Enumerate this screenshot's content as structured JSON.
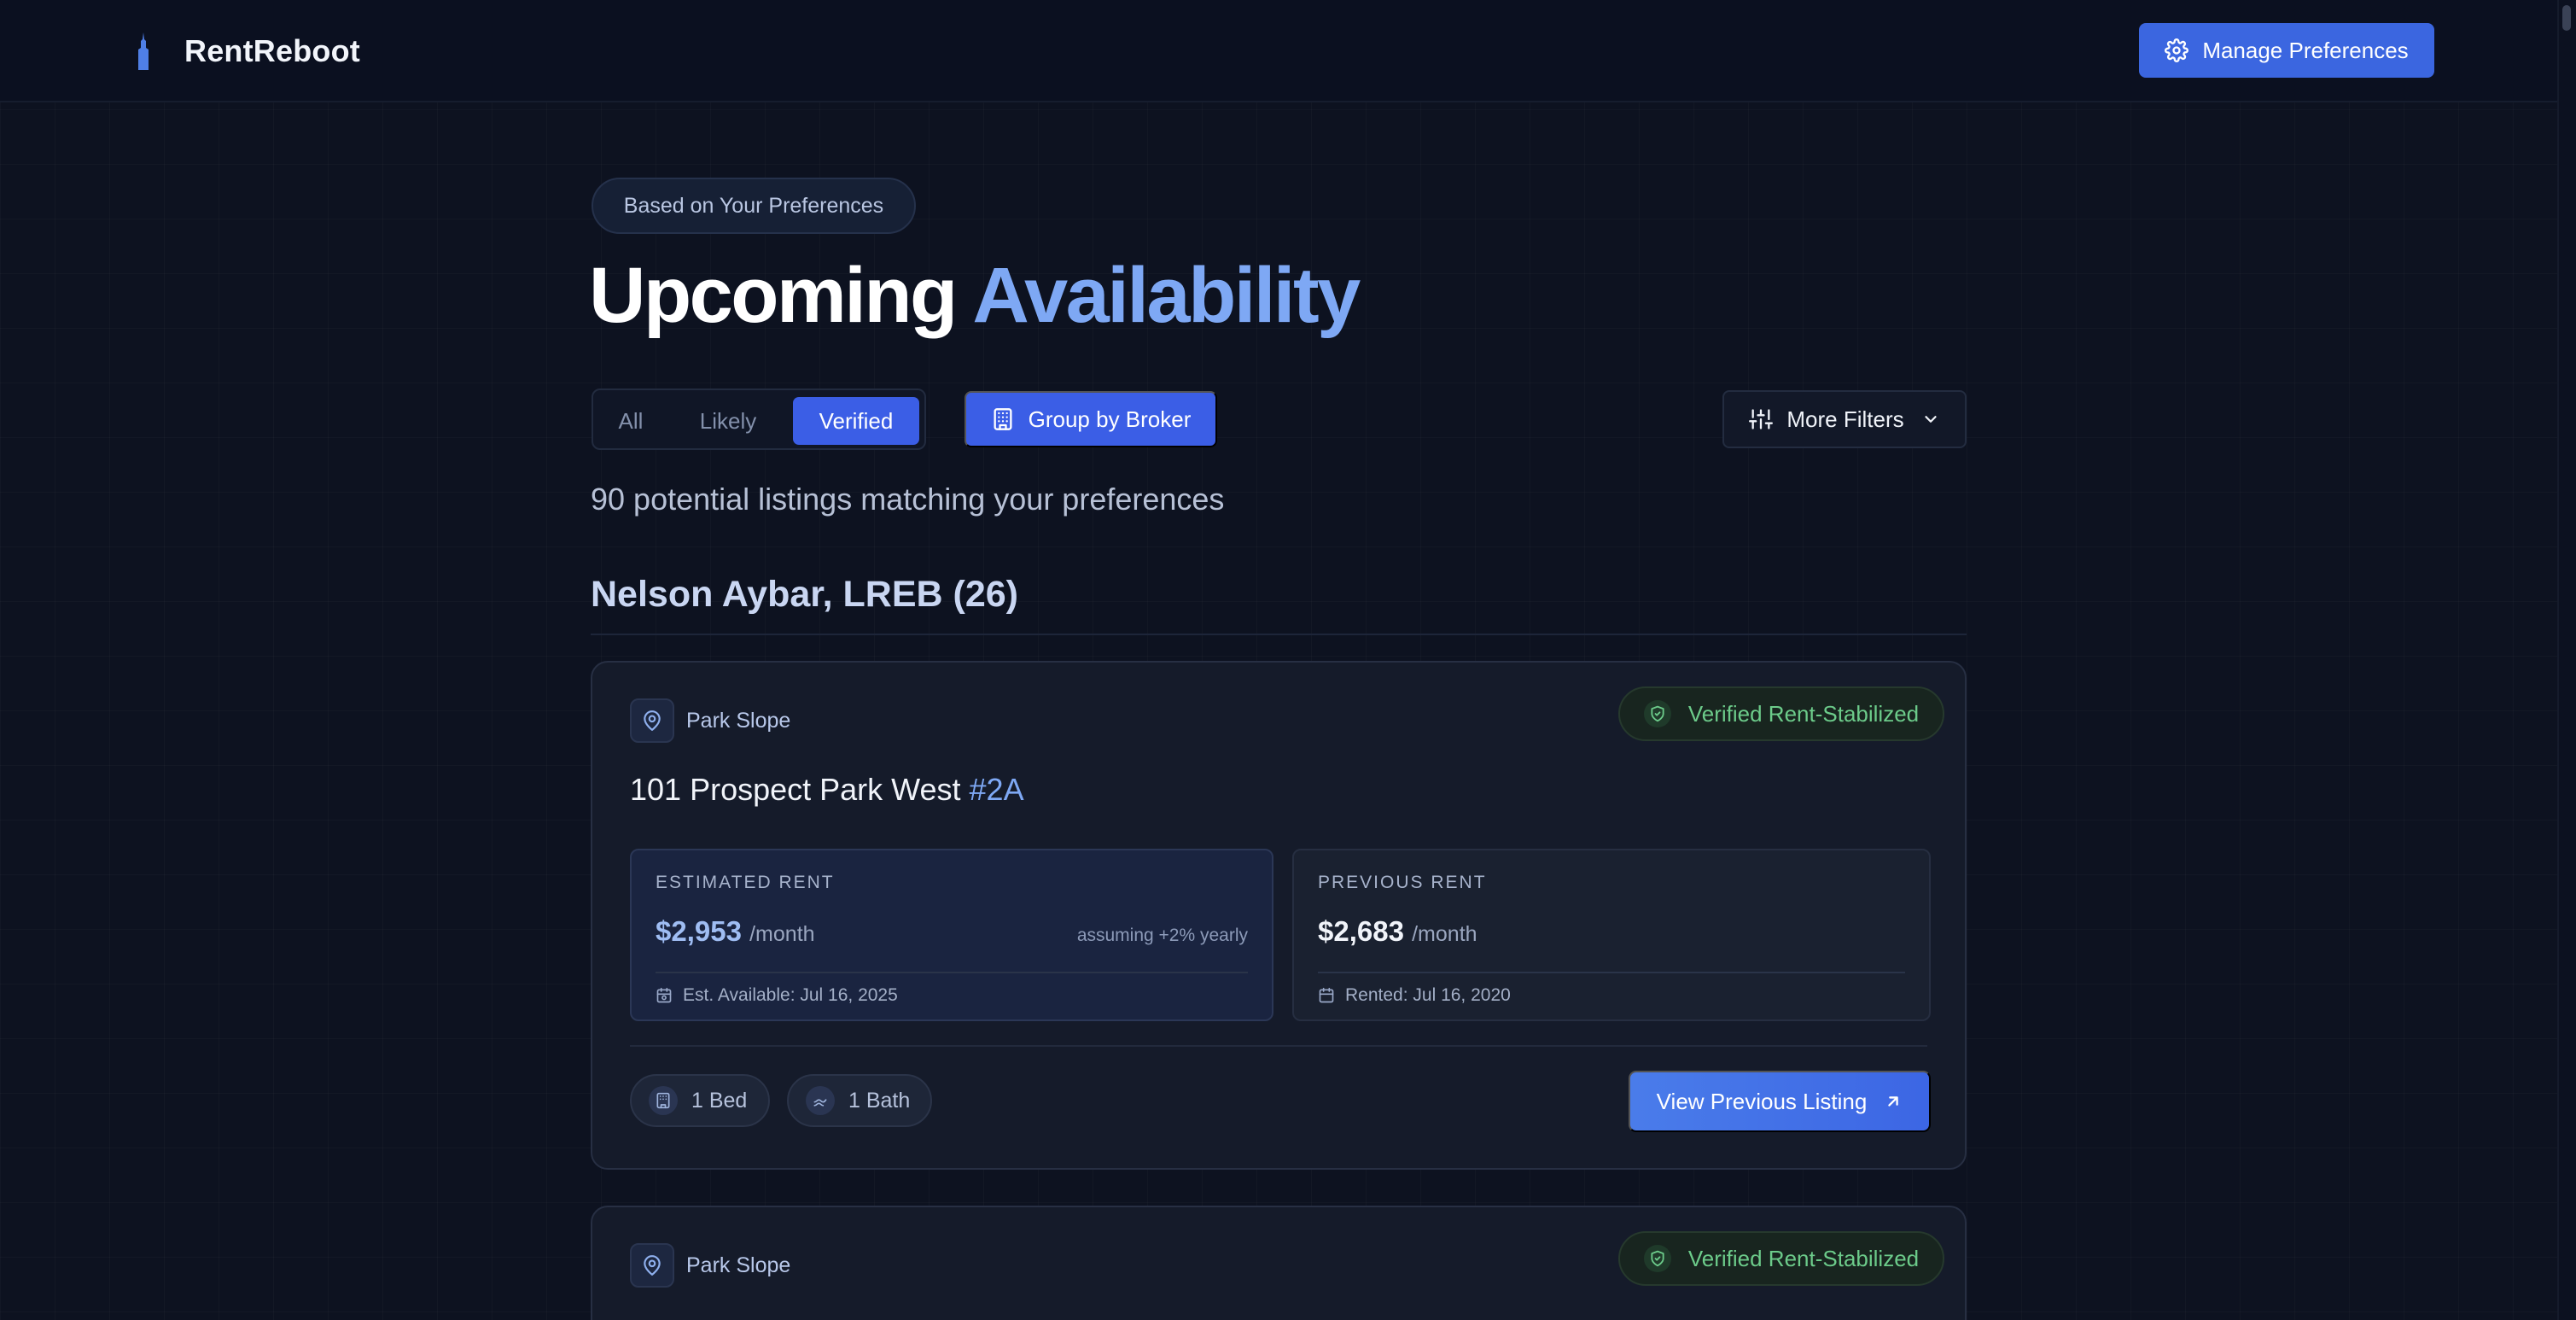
{
  "app": {
    "name": "RentReboot"
  },
  "header": {
    "manage_label": "Manage Preferences"
  },
  "hero": {
    "badge": "Based on Your Preferences",
    "title_main": "Upcoming",
    "title_accent": "Availability"
  },
  "filters": {
    "tabs": [
      {
        "label": "All",
        "selected": false
      },
      {
        "label": "Likely",
        "selected": false
      },
      {
        "label": "Verified",
        "selected": true
      }
    ],
    "group_label": "Group by Broker",
    "more_label": "More Filters"
  },
  "summary": {
    "count_text": "90 potential listings matching your preferences"
  },
  "groups": [
    {
      "title": "Nelson Aybar, LREB (26)",
      "listings": [
        {
          "neighborhood": "Park Slope",
          "badge": "Verified Rent-Stabilized",
          "address": "101 Prospect Park West",
          "unit": "#2A",
          "estimated": {
            "label": "ESTIMATED RENT",
            "amount": "$2,953",
            "per": "/month",
            "note": "assuming +2% yearly",
            "date": "Est. Available: Jul 16, 2025"
          },
          "previous": {
            "label": "PREVIOUS RENT",
            "amount": "$2,683",
            "per": "/month",
            "date": "Rented: Jul 16, 2020"
          },
          "beds": "1 Bed",
          "baths": "1 Bath",
          "view_label": "View Previous Listing"
        },
        {
          "neighborhood": "Park Slope",
          "badge": "Verified Rent-Stabilized"
        }
      ]
    }
  ],
  "colors": {
    "background": "#0d1220",
    "accent": "#3b5ee6",
    "accent_text": "#7ea8f4",
    "verified_green": "#6ccb8a"
  }
}
